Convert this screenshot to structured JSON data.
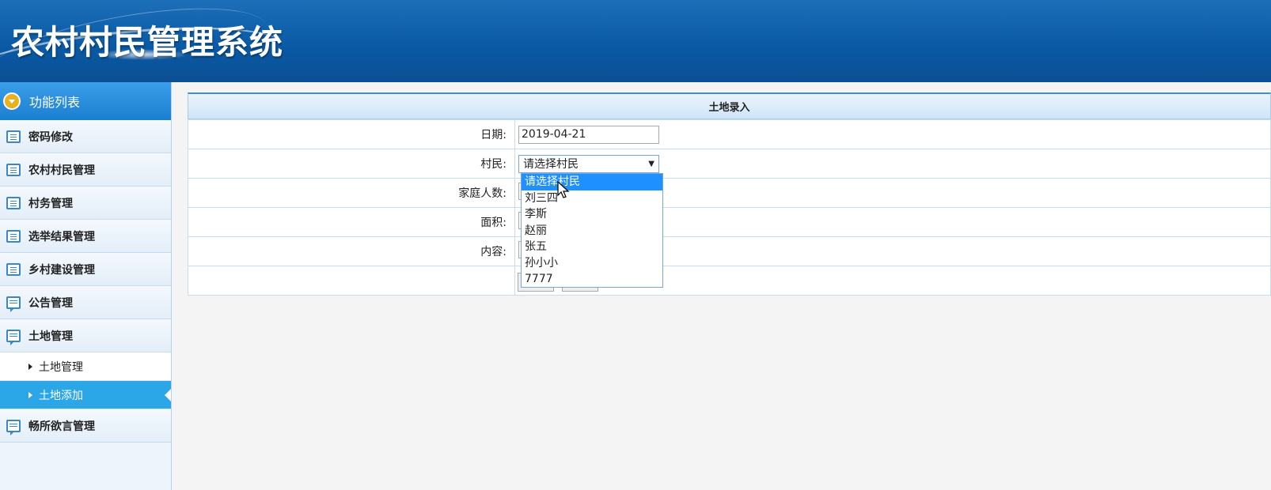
{
  "header": {
    "title": "农村村民管理系统"
  },
  "sidebar": {
    "heading": "功能列表",
    "items": [
      {
        "label": "密码修改",
        "icon": "list-icon"
      },
      {
        "label": "农村村民管理",
        "icon": "list-icon"
      },
      {
        "label": "村务管理",
        "icon": "list-icon"
      },
      {
        "label": "选举结果管理",
        "icon": "list-icon"
      },
      {
        "label": "乡村建设管理",
        "icon": "list-icon"
      },
      {
        "label": "公告管理",
        "icon": "chat-icon"
      },
      {
        "label": "土地管理",
        "icon": "chat-icon"
      }
    ],
    "subitems": [
      {
        "label": "土地管理"
      },
      {
        "label": "土地添加",
        "active": true
      }
    ],
    "last_item": {
      "label": "畅所欲言管理",
      "icon": "chat-icon"
    }
  },
  "form": {
    "title": "土地录入",
    "date_label": "日期:",
    "date_value": "2019-04-21",
    "villager_label": "村民:",
    "villager_selected": "请选择村民",
    "household_label": "家庭人数:",
    "area_label": "面积:",
    "content_label": "内容:"
  },
  "dropdown": {
    "options": [
      "请选择村民",
      "刘三四",
      "李斯",
      "赵丽",
      "张五",
      "孙小小",
      "7777"
    ],
    "highlighted_index": 0
  },
  "colors": {
    "header_bg": "#0a5aa6",
    "active_menu": "#2ba6e6",
    "highlight": "#1e90ff"
  }
}
